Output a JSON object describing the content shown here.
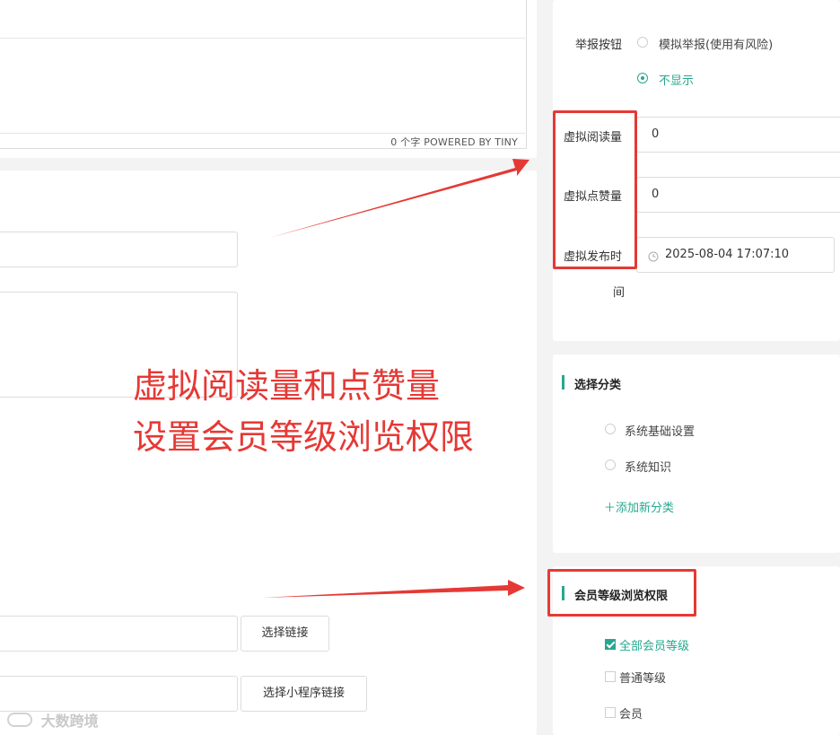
{
  "editor": {
    "status_text": "0 个字  POWERED BY TINY"
  },
  "right_panel": {
    "report_button": {
      "label": "举报按钮",
      "options": [
        {
          "label": "模拟举报(使用有风险)",
          "selected": false
        },
        {
          "label": "不显示",
          "selected": true
        }
      ]
    },
    "virtual_reads": {
      "label": "虚拟阅读量",
      "value": "0"
    },
    "virtual_likes": {
      "label": "虚拟点赞量",
      "value": "0"
    },
    "virtual_publish_time": {
      "label_line1": "虚拟发布时",
      "label_line2": "间",
      "value": "2025-08-04 17:07:10"
    },
    "category": {
      "title": "选择分类",
      "options": [
        {
          "label": "系统基础设置",
          "selected": false
        },
        {
          "label": "系统知识",
          "selected": false
        }
      ],
      "add_label": "＋添加新分类"
    },
    "member_permission": {
      "title": "会员等级浏览权限",
      "options": [
        {
          "label": "全部会员等级",
          "checked": true
        },
        {
          "label": "普通等级",
          "checked": false
        },
        {
          "label": "会员",
          "checked": false
        }
      ]
    }
  },
  "left_buttons": {
    "select_link": "选择链接",
    "select_miniprogram_link": "选择小程序链接"
  },
  "annotation": {
    "line1": "虚拟阅读量和点赞量",
    "line2": "设置会员等级浏览权限",
    "color": "#e53935"
  },
  "watermark": {
    "text": "大数跨境"
  },
  "colors": {
    "accent": "#26a88f",
    "panel_bg": "#f3f3f3"
  }
}
